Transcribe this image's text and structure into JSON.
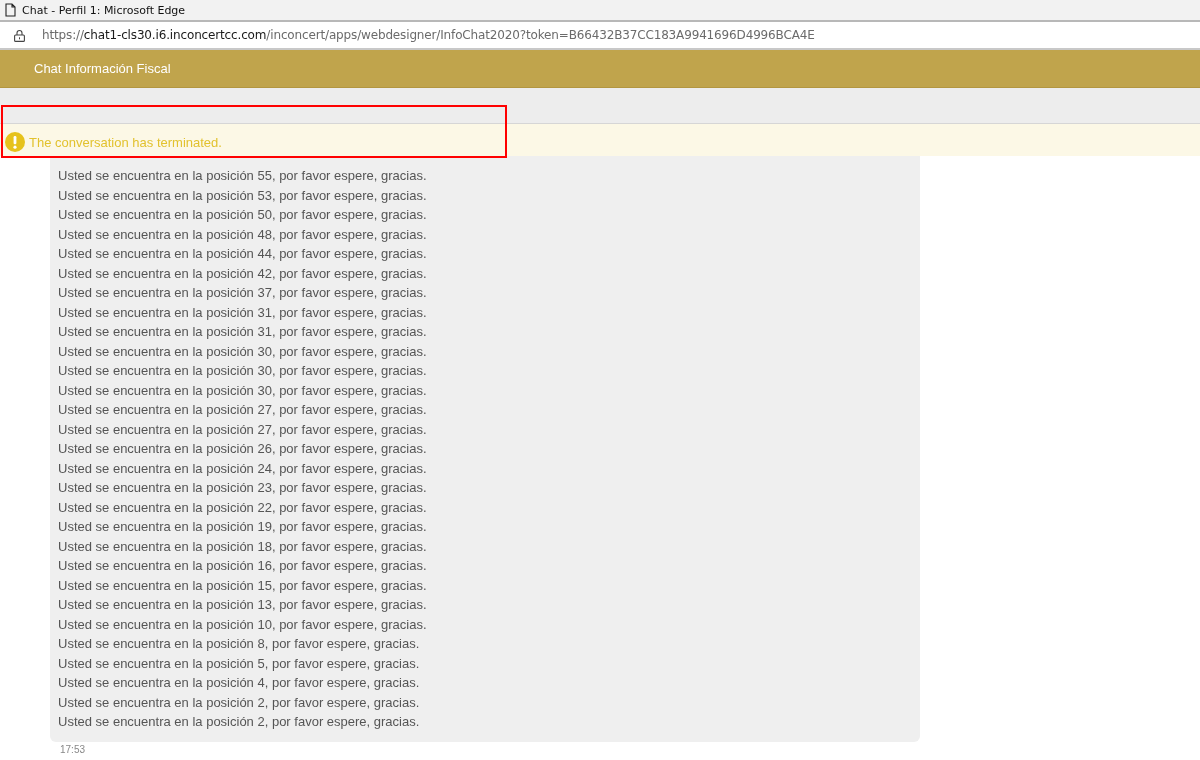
{
  "window": {
    "title": "Chat - Perfil 1: Microsoft Edge"
  },
  "address_bar": {
    "scheme": "https://",
    "host": "chat1-cls30.i6.inconcertcc.com",
    "path": "/inconcert/apps/webdesigner/InfoChat2020?token=B66432B37CC183A9941696D4996BCA4E"
  },
  "header": {
    "title": "Chat Información Fiscal"
  },
  "notice": {
    "kind": "warning",
    "text": "The conversation has terminated.",
    "highlighted": true
  },
  "message": {
    "lines": [
      "Usted se encuentra en la posición 55, por favor espere, gracias.",
      "Usted se encuentra en la posición 53, por favor espere, gracias.",
      "Usted se encuentra en la posición 50, por favor espere, gracias.",
      "Usted se encuentra en la posición 48, por favor espere, gracias.",
      "Usted se encuentra en la posición 44, por favor espere, gracias.",
      "Usted se encuentra en la posición 42, por favor espere, gracias.",
      "Usted se encuentra en la posición 37, por favor espere, gracias.",
      "Usted se encuentra en la posición 31, por favor espere, gracias.",
      "Usted se encuentra en la posición 31, por favor espere, gracias.",
      "Usted se encuentra en la posición 30, por favor espere, gracias.",
      "Usted se encuentra en la posición 30, por favor espere, gracias.",
      "Usted se encuentra en la posición 30, por favor espere, gracias.",
      "Usted se encuentra en la posición 27, por favor espere, gracias.",
      "Usted se encuentra en la posición 27, por favor espere, gracias.",
      "Usted se encuentra en la posición 26, por favor espere, gracias.",
      "Usted se encuentra en la posición 24, por favor espere, gracias.",
      "Usted se encuentra en la posición 23, por favor espere, gracias.",
      "Usted se encuentra en la posición 22, por favor espere, gracias.",
      "Usted se encuentra en la posición 19, por favor espere, gracias.",
      "Usted se encuentra en la posición 18, por favor espere, gracias.",
      "Usted se encuentra en la posición 16, por favor espere, gracias.",
      "Usted se encuentra en la posición 15, por favor espere, gracias.",
      "Usted se encuentra en la posición 13, por favor espere, gracias.",
      "Usted se encuentra en la posición 10, por favor espere, gracias.",
      "Usted se encuentra en la posición 8, por favor espere, gracias.",
      "Usted se encuentra en la posición 5, por favor espere, gracias.",
      "Usted se encuentra en la posición 4, por favor espere, gracias.",
      "Usted se encuentra en la posición 2, por favor espere, gracias.",
      "Usted se encuentra en la posición 2, por favor espere, gracias."
    ],
    "time": "17:53"
  }
}
